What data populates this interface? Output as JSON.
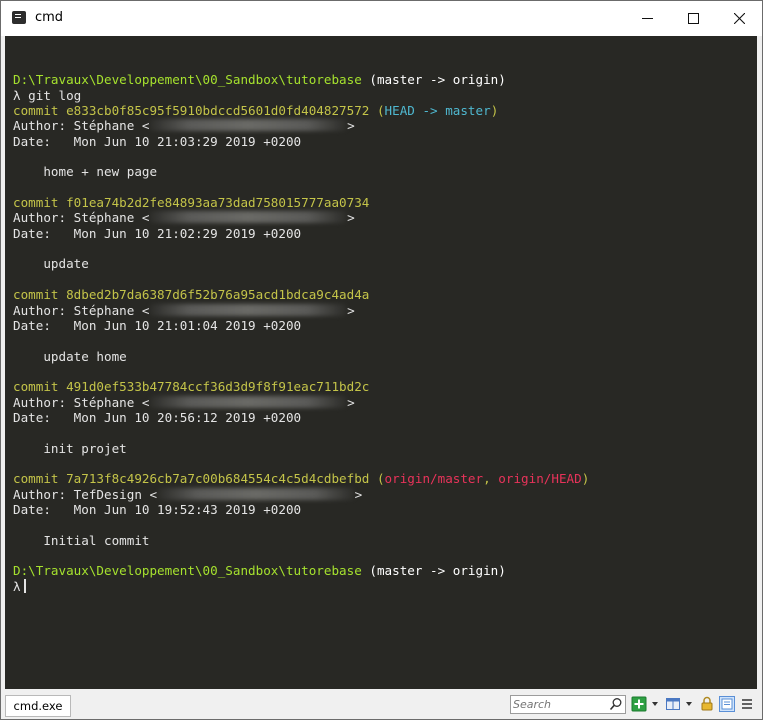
{
  "window": {
    "title": "cmd",
    "minimize_symbol": "—",
    "maximize_symbol": "☐",
    "close_symbol": "✕"
  },
  "terminal": {
    "lines": [
      {
        "segments": []
      },
      {
        "segments": [
          {
            "text": "D:\\Travaux\\Developpement\\00_Sandbox\\tutorebase",
            "cls": "c-path"
          },
          {
            "text": " (master -> origin)",
            "cls": "c-branch"
          }
        ]
      },
      {
        "segments": [
          {
            "text": "λ git log",
            "cls": ""
          }
        ]
      },
      {
        "segments": [
          {
            "text": "commit e833cb0f85c95f5910bdccd5601d0fd404827572",
            "cls": "c-commit"
          },
          {
            "text": " (",
            "cls": "c-commit"
          },
          {
            "text": "HEAD -> master",
            "cls": "c-head"
          },
          {
            "text": ")",
            "cls": "c-commit"
          }
        ]
      },
      {
        "segments": [
          {
            "text": "Author: Stéphane <",
            "cls": ""
          },
          {
            "redact": 26
          },
          {
            "text": ">",
            "cls": ""
          }
        ]
      },
      {
        "segments": [
          {
            "text": "Date:   Mon Jun 10 21:03:29 2019 +0200",
            "cls": ""
          }
        ]
      },
      {
        "segments": []
      },
      {
        "segments": [
          {
            "text": "    home + new page",
            "cls": ""
          }
        ]
      },
      {
        "segments": []
      },
      {
        "segments": [
          {
            "text": "commit f01ea74b2d2fe84893aa73dad758015777aa0734",
            "cls": "c-commit"
          }
        ]
      },
      {
        "segments": [
          {
            "text": "Author: Stéphane <",
            "cls": ""
          },
          {
            "redact": 26
          },
          {
            "text": ">",
            "cls": ""
          }
        ]
      },
      {
        "segments": [
          {
            "text": "Date:   Mon Jun 10 21:02:29 2019 +0200",
            "cls": ""
          }
        ]
      },
      {
        "segments": []
      },
      {
        "segments": [
          {
            "text": "    update",
            "cls": ""
          }
        ]
      },
      {
        "segments": []
      },
      {
        "segments": [
          {
            "text": "commit 8dbed2b7da6387d6f52b76a95acd1bdca9c4ad4a",
            "cls": "c-commit"
          }
        ]
      },
      {
        "segments": [
          {
            "text": "Author: Stéphane <",
            "cls": ""
          },
          {
            "redact": 26
          },
          {
            "text": ">",
            "cls": ""
          }
        ]
      },
      {
        "segments": [
          {
            "text": "Date:   Mon Jun 10 21:01:04 2019 +0200",
            "cls": ""
          }
        ]
      },
      {
        "segments": []
      },
      {
        "segments": [
          {
            "text": "    update home",
            "cls": ""
          }
        ]
      },
      {
        "segments": []
      },
      {
        "segments": [
          {
            "text": "commit 491d0ef533b47784ccf36d3d9f8f91eac711bd2c",
            "cls": "c-commit"
          }
        ]
      },
      {
        "segments": [
          {
            "text": "Author: Stéphane <",
            "cls": ""
          },
          {
            "redact": 26
          },
          {
            "text": ">",
            "cls": ""
          }
        ]
      },
      {
        "segments": [
          {
            "text": "Date:   Mon Jun 10 20:56:12 2019 +0200",
            "cls": ""
          }
        ]
      },
      {
        "segments": []
      },
      {
        "segments": [
          {
            "text": "    init projet",
            "cls": ""
          }
        ]
      },
      {
        "segments": []
      },
      {
        "segments": [
          {
            "text": "commit 7a713f8c4926cb7a7c00b684554c4c5d4cdbefbd",
            "cls": "c-commit"
          },
          {
            "text": " (",
            "cls": "c-commit"
          },
          {
            "text": "origin/master",
            "cls": "c-origin"
          },
          {
            "text": ", ",
            "cls": "c-commit"
          },
          {
            "text": "origin/HEAD",
            "cls": "c-origin"
          },
          {
            "text": ")",
            "cls": "c-commit"
          }
        ]
      },
      {
        "segments": [
          {
            "text": "Author: TefDesign <",
            "cls": ""
          },
          {
            "redact": 26
          },
          {
            "text": ">",
            "cls": ""
          }
        ]
      },
      {
        "segments": [
          {
            "text": "Date:   Mon Jun 10 19:52:43 2019 +0200",
            "cls": ""
          }
        ]
      },
      {
        "segments": []
      },
      {
        "segments": [
          {
            "text": "    Initial commit",
            "cls": ""
          }
        ]
      },
      {
        "segments": []
      },
      {
        "segments": [
          {
            "text": "D:\\Travaux\\Developpement\\00_Sandbox\\tutorebase",
            "cls": "c-path"
          },
          {
            "text": " (master -> origin)",
            "cls": "c-branch"
          }
        ]
      },
      {
        "segments": [
          {
            "text": "λ",
            "cls": ""
          }
        ],
        "cursor": true
      }
    ]
  },
  "statusbar": {
    "tab_label": "cmd.exe",
    "search_placeholder": "Search"
  },
  "icons": {
    "app": "terminal-icon",
    "search": "search-icon",
    "new_console": "plus-icon",
    "layout": "split-view-icon",
    "lock": "lock-icon",
    "view_mode": "console-view-icon",
    "menu": "hamburger-icon"
  },
  "colors": {
    "terminal_bg": "#282824",
    "path": "#a6e22e",
    "commit": "#c4c449",
    "head_ref": "#4fb8d0",
    "origin_ref": "#e8335a",
    "text": "#e4e4e4"
  }
}
